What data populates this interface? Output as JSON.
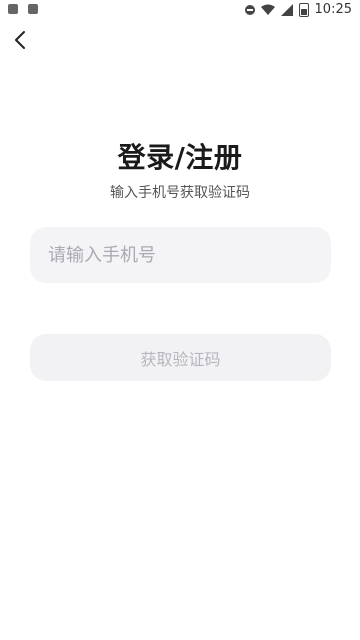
{
  "status_bar": {
    "time": "10:25",
    "icons": [
      "image-icon",
      "text-a-icon",
      "do-not-disturb-icon",
      "wifi-icon",
      "signal-icon",
      "battery-icon"
    ]
  },
  "header": {
    "back_icon": "chevron-left-icon"
  },
  "main": {
    "title": "登录/注册",
    "subtitle": "输入手机号获取验证码",
    "phone_input": {
      "placeholder": "请输入手机号",
      "value": ""
    },
    "get_code_button_label": "获取验证码"
  },
  "colors": {
    "background": "#ffffff",
    "input_background": "#f4f4f6",
    "placeholder": "#a9a9b3",
    "button_background": "#f2f2f4",
    "button_text_disabled": "#b6b6bf"
  }
}
